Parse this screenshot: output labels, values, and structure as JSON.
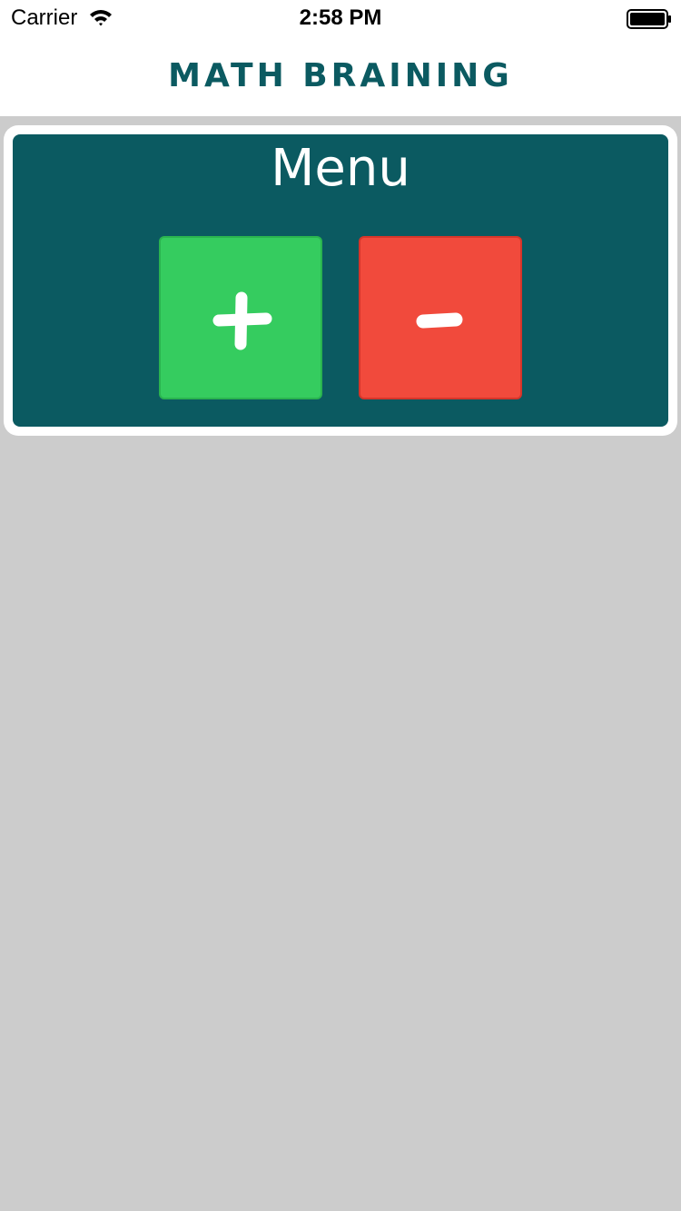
{
  "status_bar": {
    "carrier": "Carrier",
    "time": "2:58 PM",
    "wifi_icon": "wifi-icon",
    "battery_icon": "battery-full-icon"
  },
  "nav_bar": {
    "title": "MATH BRAINING"
  },
  "menu": {
    "title": "Menu",
    "buttons": [
      {
        "label": "+",
        "icon": "plus-icon",
        "color": "#35cc5f"
      },
      {
        "label": "−",
        "icon": "minus-icon",
        "color": "#f14a3c"
      }
    ]
  },
  "colors": {
    "accent": "#0b5a61",
    "background": "#cccccc",
    "card_border": "#ffffff"
  }
}
